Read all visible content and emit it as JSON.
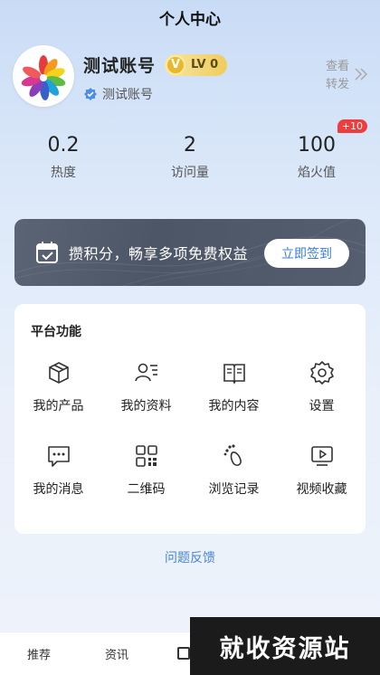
{
  "header": {
    "title": "个人中心"
  },
  "profile": {
    "name": "测试账号",
    "vip_letter": "V",
    "level": "LV 0",
    "verified_label": "测试账号",
    "view_share": [
      "查看",
      "转发"
    ]
  },
  "stats": [
    {
      "value": "0.2",
      "label": "热度"
    },
    {
      "value": "2",
      "label": "访问量"
    },
    {
      "value": "100",
      "label": "焰火值",
      "badge": "+10"
    }
  ],
  "banner": {
    "text": "攒积分，畅享多项免费权益",
    "button": "立即签到"
  },
  "platform": {
    "title": "平台功能",
    "items": [
      {
        "label": "我的产品",
        "icon": "box-icon"
      },
      {
        "label": "我的资料",
        "icon": "profile-card-icon"
      },
      {
        "label": "我的内容",
        "icon": "book-icon"
      },
      {
        "label": "设置",
        "icon": "gear-icon"
      },
      {
        "label": "我的消息",
        "icon": "message-icon"
      },
      {
        "label": "二维码",
        "icon": "qr-code-icon"
      },
      {
        "label": "浏览记录",
        "icon": "footprint-icon"
      },
      {
        "label": "视频收藏",
        "icon": "video-icon"
      }
    ]
  },
  "feedback": "问题反馈",
  "bottom_nav": [
    {
      "label": "推荐"
    },
    {
      "label": "资讯"
    }
  ],
  "watermark": "就收资源站",
  "colors": {
    "accent": "#3b7ddd",
    "badge_red": "#ef3d3d",
    "banner_bg": "#545e6f",
    "gold": "#f0cc5a"
  }
}
